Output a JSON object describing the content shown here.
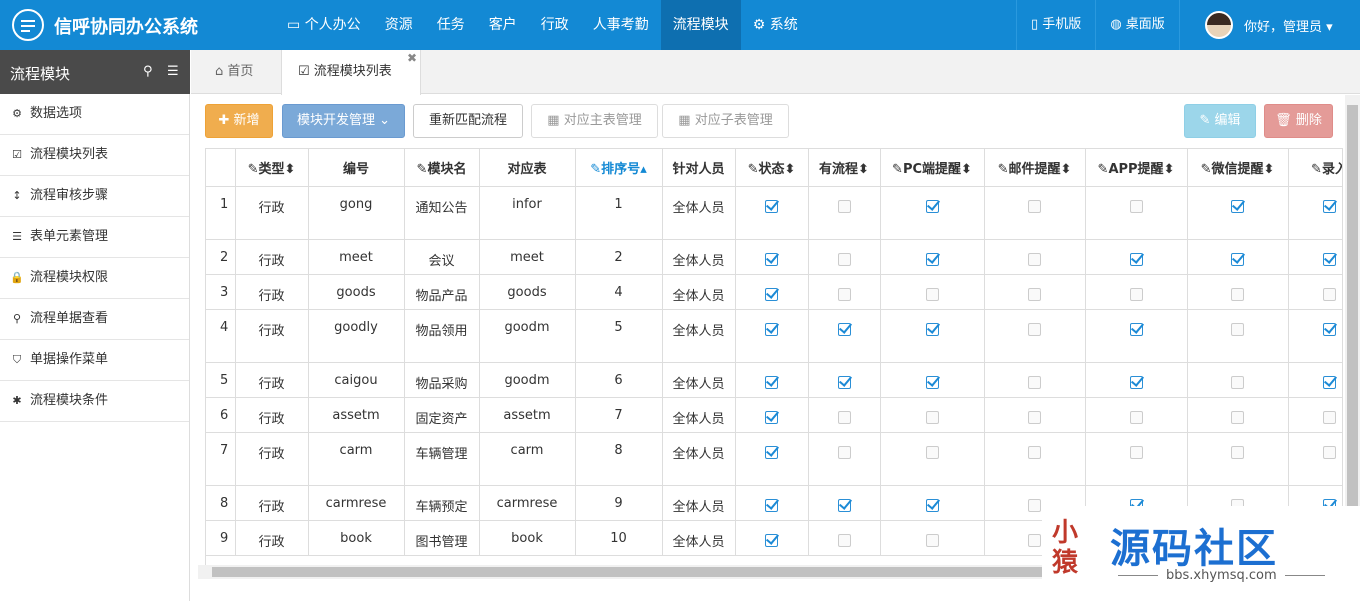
{
  "app": {
    "title": "信呼协同办公系统"
  },
  "nav": [
    {
      "icon": "monitor-icon",
      "label": "个人办公"
    },
    {
      "label": "资源"
    },
    {
      "label": "任务"
    },
    {
      "label": "客户"
    },
    {
      "label": "行政"
    },
    {
      "label": "人事考勤"
    },
    {
      "label": "流程模块",
      "active": true
    },
    {
      "icon": "gear-icon",
      "label": "系统"
    }
  ],
  "right_nav": {
    "mobile": "手机版",
    "desktop": "桌面版",
    "greeting": "你好，管理员"
  },
  "sidebar": {
    "title": "流程模块",
    "items": [
      {
        "icon": "gear-icon",
        "label": "数据选项"
      },
      {
        "icon": "checkbox-icon",
        "label": "流程模块列表"
      },
      {
        "icon": "vertical-arrows-icon",
        "label": "流程审核步骤"
      },
      {
        "icon": "list-icon",
        "label": "表单元素管理"
      },
      {
        "icon": "lock-icon",
        "label": "流程模块权限"
      },
      {
        "icon": "search-icon",
        "label": "流程单据查看"
      },
      {
        "icon": "bookmark-icon",
        "label": "单据操作菜单"
      },
      {
        "icon": "asterisk-icon",
        "label": "流程模块条件"
      }
    ]
  },
  "tabs": {
    "home": "首页",
    "current": "流程模块列表"
  },
  "toolbar": {
    "add": "新增",
    "dev": "模块开发管理",
    "rematch": "重新匹配流程",
    "main_table": "对应主表管理",
    "sub_table": "对应子表管理",
    "edit": "编辑",
    "delete": "删除"
  },
  "table": {
    "columns": [
      "",
      "类型",
      "编号",
      "模块名",
      "对应表",
      "排序号",
      "针对人员",
      "状态",
      "有流程",
      "PC端提醒",
      "邮件提醒",
      "APP提醒",
      "微信提醒",
      "录入"
    ],
    "rows": [
      {
        "n": "1",
        "type": "行政",
        "code": "gong",
        "name": "通知公告",
        "table": "infor",
        "sort": "1",
        "who": "全体人员",
        "checks": [
          true,
          false,
          true,
          false,
          false,
          true,
          true
        ],
        "tall": true
      },
      {
        "n": "2",
        "type": "行政",
        "code": "meet",
        "name": "会议",
        "table": "meet",
        "sort": "2",
        "who": "全体人员",
        "checks": [
          true,
          false,
          true,
          false,
          true,
          true,
          true
        ],
        "tall": false
      },
      {
        "n": "3",
        "type": "行政",
        "code": "goods",
        "name": "物品产品",
        "table": "goods",
        "sort": "4",
        "who": "全体人员",
        "checks": [
          true,
          false,
          false,
          false,
          false,
          false,
          false
        ],
        "tall": false
      },
      {
        "n": "4",
        "type": "行政",
        "code": "goodly",
        "name": "物品领用",
        "table": "goodm",
        "sort": "5",
        "who": "全体人员",
        "checks": [
          true,
          true,
          true,
          false,
          true,
          false,
          true
        ],
        "tall": true
      },
      {
        "n": "5",
        "type": "行政",
        "code": "caigou",
        "name": "物品采购",
        "table": "goodm",
        "sort": "6",
        "who": "全体人员",
        "checks": [
          true,
          true,
          true,
          false,
          true,
          false,
          true
        ],
        "tall": false
      },
      {
        "n": "6",
        "type": "行政",
        "code": "assetm",
        "name": "固定资产",
        "table": "assetm",
        "sort": "7",
        "who": "全体人员",
        "checks": [
          true,
          false,
          false,
          false,
          false,
          false,
          false
        ],
        "tall": false
      },
      {
        "n": "7",
        "type": "行政",
        "code": "carm",
        "name": "车辆管理",
        "table": "carm",
        "sort": "8",
        "who": "全体人员",
        "checks": [
          true,
          false,
          false,
          false,
          false,
          false,
          false
        ],
        "tall": true
      },
      {
        "n": "8",
        "type": "行政",
        "code": "carmrese",
        "name": "车辆预定",
        "table": "carmrese",
        "sort": "9",
        "who": "全体人员",
        "checks": [
          true,
          true,
          true,
          false,
          true,
          false,
          true
        ],
        "tall": false
      },
      {
        "n": "9",
        "type": "行政",
        "code": "book",
        "name": "图书管理",
        "table": "book",
        "sort": "10",
        "who": "全体人员",
        "checks": [
          true,
          false,
          false,
          false,
          false,
          false,
          false
        ],
        "tall": false
      }
    ]
  },
  "watermark": {
    "logo": "小猿",
    "title": "源码社区",
    "url": "bbs.xhymsq.com"
  }
}
